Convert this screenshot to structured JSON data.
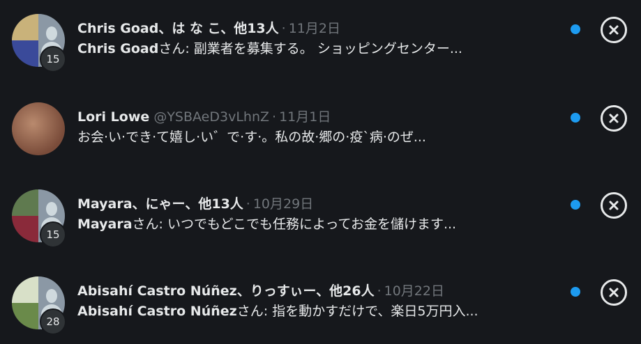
{
  "notifications": [
    {
      "name": "Chris Goad、は な こ、他13人",
      "handle": "",
      "date": "11月2日",
      "sender": "Chris Goad",
      "message": "さん: 副業者を募集する。 ショッピングセンター...",
      "count": "15",
      "avatar_type": "group",
      "colors": [
        "#c9b27a",
        "#3a4a9a"
      ]
    },
    {
      "name": "Lori Lowe",
      "handle": "@YSBAeD3vLhnZ",
      "date": "11月1日",
      "sender": "",
      "message": "お会‧い‧でき‧て嬉し‧い゛で‧す‧。私の故‧郷の‧疫`病‧のぜ...",
      "count": "",
      "avatar_type": "single",
      "colors": [
        "#b98a6e",
        "#7a4c3a"
      ]
    },
    {
      "name": "Mayara、にゃー、他13人",
      "handle": "",
      "date": "10月29日",
      "sender": "Mayara",
      "message": "さん: いつでもどこでも任務によってお金を儲けます...",
      "count": "15",
      "avatar_type": "group",
      "colors": [
        "#5f7a4f",
        "#8a2a3a"
      ]
    },
    {
      "name": "Abisahí Castro Núñez、りっすぃー、他26人",
      "handle": "",
      "date": "10月22日",
      "sender": "Abisahí Castro Núñez",
      "message": "さん: 指を動かすだけで、楽日5万円入...",
      "count": "28",
      "avatar_type": "group",
      "colors": [
        "#d8e0c8",
        "#6a8a4a"
      ]
    }
  ],
  "separator": "·",
  "accent": "#1d9bf0",
  "icons": {
    "dismiss": "close-icon",
    "unread": "unread-dot"
  }
}
